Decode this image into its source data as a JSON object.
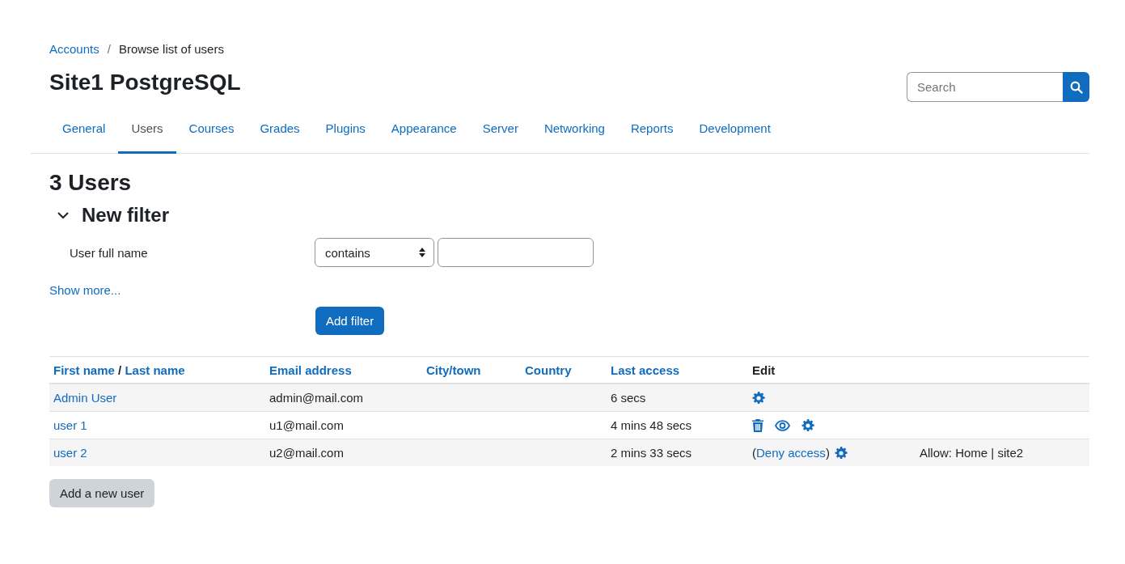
{
  "breadcrumb_separator": "/",
  "breadcrumb": [
    {
      "label": "Accounts",
      "link": true
    },
    {
      "label": "Browse list of users",
      "link": false
    }
  ],
  "site_title": "Site1 PostgreSQL",
  "search": {
    "placeholder": "Search"
  },
  "tabs": [
    {
      "label": "General",
      "selected": false
    },
    {
      "label": "Users",
      "selected": true
    },
    {
      "label": "Courses",
      "selected": false
    },
    {
      "label": "Grades",
      "selected": false
    },
    {
      "label": "Plugins",
      "selected": false
    },
    {
      "label": "Appearance",
      "selected": false
    },
    {
      "label": "Server",
      "selected": false
    },
    {
      "label": "Networking",
      "selected": false
    },
    {
      "label": "Reports",
      "selected": false
    },
    {
      "label": "Development",
      "selected": false
    }
  ],
  "heading": "3 Users",
  "filter": {
    "title": "New filter",
    "expanded": true,
    "field_label": "User full name",
    "operator": "contains",
    "show_more": "Show more...",
    "add_button": "Add filter"
  },
  "table": {
    "columns": [
      {
        "parts": [
          "First name",
          "/",
          "Last name"
        ]
      },
      {
        "parts": [
          "Email address"
        ]
      },
      {
        "parts": [
          "City/town"
        ]
      },
      {
        "parts": [
          "Country"
        ]
      },
      {
        "parts": [
          "Last access"
        ]
      },
      {
        "parts": [
          "Edit"
        ],
        "plain": true
      }
    ],
    "rows": [
      {
        "name": "Admin User",
        "email": "admin@mail.com",
        "last_access": "6 secs",
        "actions": [
          {
            "kind": "settings"
          }
        ]
      },
      {
        "name": "user 1",
        "email": "u1@mail.com",
        "last_access": "4 mins 48 secs",
        "actions": [
          {
            "kind": "delete"
          },
          {
            "kind": "view"
          },
          {
            "kind": "settings"
          }
        ]
      },
      {
        "name": "user 2",
        "email": "u2@mail.com",
        "last_access": "2 mins 33 secs",
        "actions": [
          {
            "kind": "deny",
            "open": "(",
            "label": "Deny access",
            "close": ")"
          },
          {
            "kind": "settings"
          }
        ],
        "note": "Allow: Home | site2"
      }
    ]
  },
  "add_user_button": "Add a new user"
}
